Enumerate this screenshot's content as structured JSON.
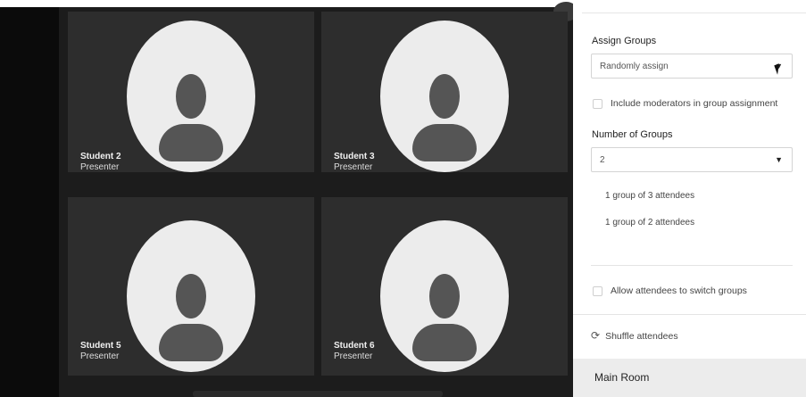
{
  "tiles": [
    {
      "name": "Student 2",
      "role": "Presenter"
    },
    {
      "name": "Student 3",
      "role": "Presenter"
    },
    {
      "name": "Student 5",
      "role": "Presenter"
    },
    {
      "name": "Student 6",
      "role": "Presenter"
    }
  ],
  "panel": {
    "assign_groups_label": "Assign Groups",
    "assign_select_value": "Randomly assign",
    "include_moderators_label": "Include moderators in group assignment",
    "include_moderators_checked": false,
    "number_of_groups_label": "Number of Groups",
    "number_select_value": "2",
    "group_info": [
      "1 group of 3 attendees",
      "1 group of 2 attendees"
    ],
    "allow_switch_label": "Allow attendees to switch groups",
    "allow_switch_checked": false,
    "shuffle_label": "Shuffle attendees",
    "main_room_label": "Main Room"
  },
  "icons": {
    "shuffle": "refresh-icon",
    "select_caret": "caret-down-icon",
    "avatar": "user-avatar-icon"
  },
  "colors": {
    "video_bg": "#1c1c1c",
    "tile_bg": "#2d2d2d",
    "avatar_bg": "#ececec",
    "avatar_fg": "#555555",
    "panel_bg": "#ffffff",
    "main_room_bg": "#ececec"
  }
}
